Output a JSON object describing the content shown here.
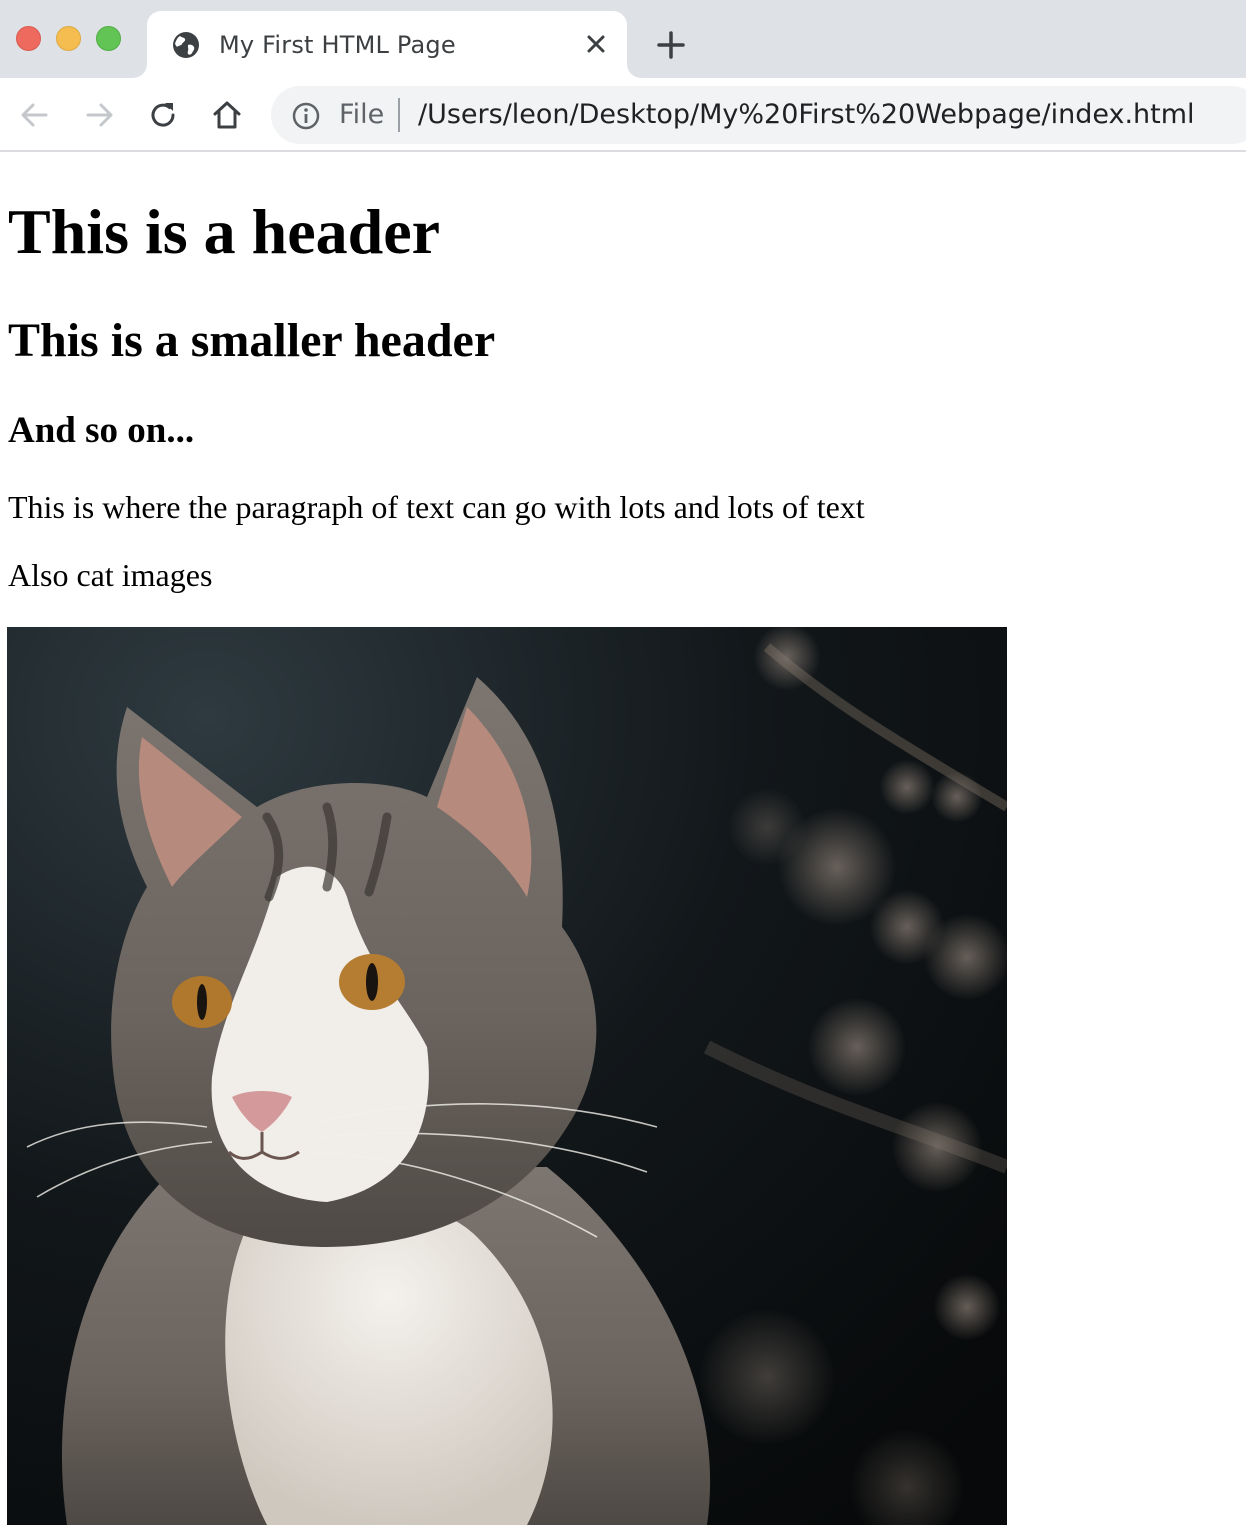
{
  "window": {
    "controls": [
      "close",
      "minimize",
      "zoom"
    ]
  },
  "tab": {
    "title": "My First HTML Page",
    "favicon": "globe-icon"
  },
  "toolbar": {
    "scheme_label": "File",
    "url": "/Users/leon/Desktop/My%20First%20Webpage/index.html"
  },
  "page": {
    "h1": "This is a header",
    "h2": "This is a smaller header",
    "h3": "And so on...",
    "paragraph": "This is where the paragraph of text can go with lots and lots of text",
    "paragraph2": "Also cat images",
    "image_subject": "grey and white tabby cat photo"
  },
  "colors": {
    "tab_strip": "#dee1e6",
    "omnibox": "#f1f3f4",
    "traffic_red": "#ee6a5f",
    "traffic_yellow": "#f5bd4f",
    "traffic_green": "#61c454"
  }
}
